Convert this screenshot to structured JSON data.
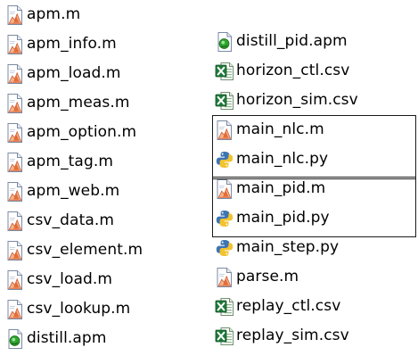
{
  "left_column": [
    {
      "name": "apm.m",
      "icon": "matlab-m-file-icon",
      "type": "m"
    },
    {
      "name": "apm_info.m",
      "icon": "matlab-m-file-icon",
      "type": "m"
    },
    {
      "name": "apm_load.m",
      "icon": "matlab-m-file-icon",
      "type": "m"
    },
    {
      "name": "apm_meas.m",
      "icon": "matlab-m-file-icon",
      "type": "m"
    },
    {
      "name": "apm_option.m",
      "icon": "matlab-m-file-icon",
      "type": "m"
    },
    {
      "name": "apm_tag.m",
      "icon": "matlab-m-file-icon",
      "type": "m"
    },
    {
      "name": "apm_web.m",
      "icon": "matlab-m-file-icon",
      "type": "m"
    },
    {
      "name": "csv_data.m",
      "icon": "matlab-m-file-icon",
      "type": "m"
    },
    {
      "name": "csv_element.m",
      "icon": "matlab-m-file-icon",
      "type": "m"
    },
    {
      "name": "csv_load.m",
      "icon": "matlab-m-file-icon",
      "type": "m"
    },
    {
      "name": "csv_lookup.m",
      "icon": "matlab-m-file-icon",
      "type": "m"
    },
    {
      "name": "distill.apm",
      "icon": "apm-file-icon",
      "type": "apm"
    }
  ],
  "right_column": [
    {
      "name": "distill_pid.apm",
      "icon": "apm-file-icon",
      "type": "apm"
    },
    {
      "name": "horizon_ctl.csv",
      "icon": "excel-csv-file-icon",
      "type": "csv"
    },
    {
      "name": "horizon_sim.csv",
      "icon": "excel-csv-file-icon",
      "type": "csv"
    },
    {
      "name": "main_nlc.m",
      "icon": "matlab-m-file-icon",
      "type": "m"
    },
    {
      "name": "main_nlc.py",
      "icon": "python-file-icon",
      "type": "py"
    },
    {
      "name": "main_pid.m",
      "icon": "matlab-m-file-icon",
      "type": "m"
    },
    {
      "name": "main_pid.py",
      "icon": "python-file-icon",
      "type": "py"
    },
    {
      "name": "main_step.py",
      "icon": "python-file-icon",
      "type": "py"
    },
    {
      "name": "parse.m",
      "icon": "matlab-m-file-icon",
      "type": "m"
    },
    {
      "name": "replay_ctl.csv",
      "icon": "excel-csv-file-icon",
      "type": "csv"
    },
    {
      "name": "replay_sim.csv",
      "icon": "excel-csv-file-icon",
      "type": "csv"
    }
  ],
  "highlight_boxes": [
    {
      "name": "main_nlc-group",
      "files": [
        "main_nlc.m",
        "main_nlc.py"
      ]
    },
    {
      "name": "main_pid-group",
      "files": [
        "main_pid.m",
        "main_pid.py"
      ]
    }
  ],
  "colors": {
    "background": "#ffffff",
    "text": "#000000",
    "box_border": "#1a1a1a"
  }
}
